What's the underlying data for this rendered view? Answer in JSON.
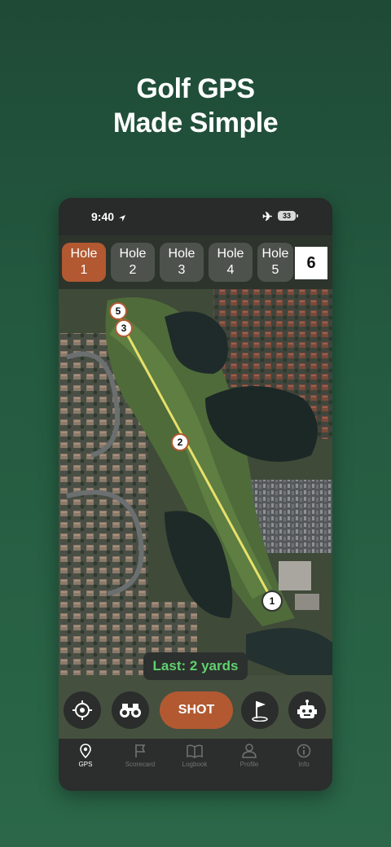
{
  "promo": {
    "line1": "Golf GPS",
    "line2": "Made Simple"
  },
  "status_bar": {
    "time": "9:40",
    "battery": "33"
  },
  "holes": {
    "tabs": [
      {
        "line1": "Hole",
        "line2": "1",
        "active": true
      },
      {
        "line1": "Hole",
        "line2": "2",
        "active": false
      },
      {
        "line1": "Hole",
        "line2": "3",
        "active": false
      },
      {
        "line1": "Hole",
        "line2": "4",
        "active": false
      },
      {
        "line1": "Hole",
        "line2": "5",
        "active": false
      }
    ],
    "current_number": "6"
  },
  "shot_markers": [
    "1",
    "2",
    "3",
    "5"
  ],
  "last_shot": "Last: 2 yards",
  "actions": {
    "shot_label": "SHOT"
  },
  "tabbar": {
    "items": [
      {
        "label": "GPS",
        "icon": "map-pin-icon",
        "active": true
      },
      {
        "label": "Scorecard",
        "icon": "flag-icon",
        "active": false
      },
      {
        "label": "Logbook",
        "icon": "book-icon",
        "active": false
      },
      {
        "label": "Profile",
        "icon": "person-icon",
        "active": false
      },
      {
        "label": "Info",
        "icon": "info-icon",
        "active": false
      }
    ]
  },
  "colors": {
    "accent": "#b25932",
    "last_shot_text": "#5fd16e",
    "shot_line": "#e8e06a"
  }
}
